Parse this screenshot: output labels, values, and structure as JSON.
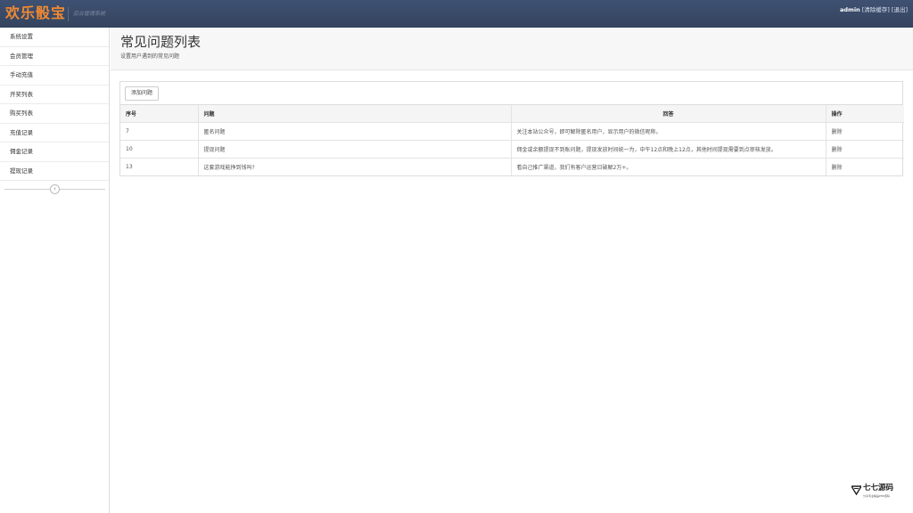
{
  "header": {
    "brand": "欢乐骰宝",
    "brand_sub": "后台管理系统",
    "user": "admin",
    "clear_cache": "[清除缓存]",
    "logout": "[退出]"
  },
  "sidebar": {
    "items": [
      {
        "label": "系统设置"
      },
      {
        "label": "会员管理"
      },
      {
        "label": "手动充值"
      },
      {
        "label": "开奖列表"
      },
      {
        "label": "购买列表"
      },
      {
        "label": "充值记录"
      },
      {
        "label": "佣金记录"
      },
      {
        "label": "提现记录"
      }
    ],
    "collapse_icon": "chevron-left-icon"
  },
  "page": {
    "title": "常见问题列表",
    "subtitle": "设置用户遇到的常见问题"
  },
  "toolbar": {
    "add_label": "添加问题"
  },
  "table": {
    "headers": [
      "序号",
      "问题",
      "回答",
      "操作"
    ],
    "rows": [
      {
        "id": "7",
        "question": "匿名问题",
        "answer": "关注本站公众号，即可解除匿名用户，显示用户的微信昵称。",
        "action": "删除"
      },
      {
        "id": "10",
        "question": "提现问题",
        "answer": "佣金或余额提现不到账问题，提现发放时间统一为，中午12点和晚上12点，其他时间提现需要到点审核发放。",
        "action": "删除"
      },
      {
        "id": "13",
        "question": "这套游戏能挣到钱吗?",
        "answer": "看自己推广渠道，我们有客户运营日破解2万+。",
        "action": "删除"
      }
    ]
  },
  "watermark": {
    "title": "七七源码",
    "subtitle": "分享专业精品PHP源码"
  },
  "colors": {
    "header_bg": "#3a4b6a",
    "brand": "#f08a33"
  }
}
